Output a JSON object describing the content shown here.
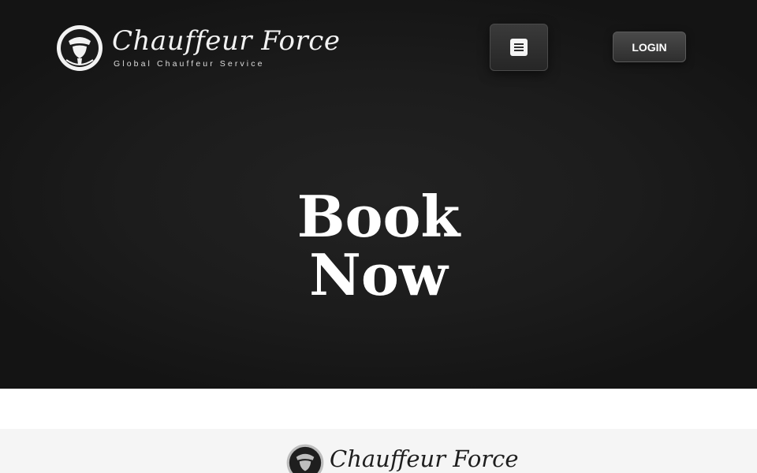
{
  "header": {
    "logo_name": "Chauffeur Force",
    "logo_tagline": "Global Chauffeur Service",
    "logo_icon": "chauffeur-emblem-icon",
    "menu_icon": "hamburger-menu-icon",
    "login_label": "LOGIN"
  },
  "hero": {
    "title_line1": "Book",
    "title_line2": "Now"
  },
  "footer": {
    "logo_name": "Chauffeur Force",
    "logo_icon": "chauffeur-emblem-icon"
  },
  "colors": {
    "hero_background": "#1c1c1c",
    "text_light": "#ffffff",
    "footer_background": "#f5f5f5",
    "footer_text": "#1e1e1e"
  }
}
